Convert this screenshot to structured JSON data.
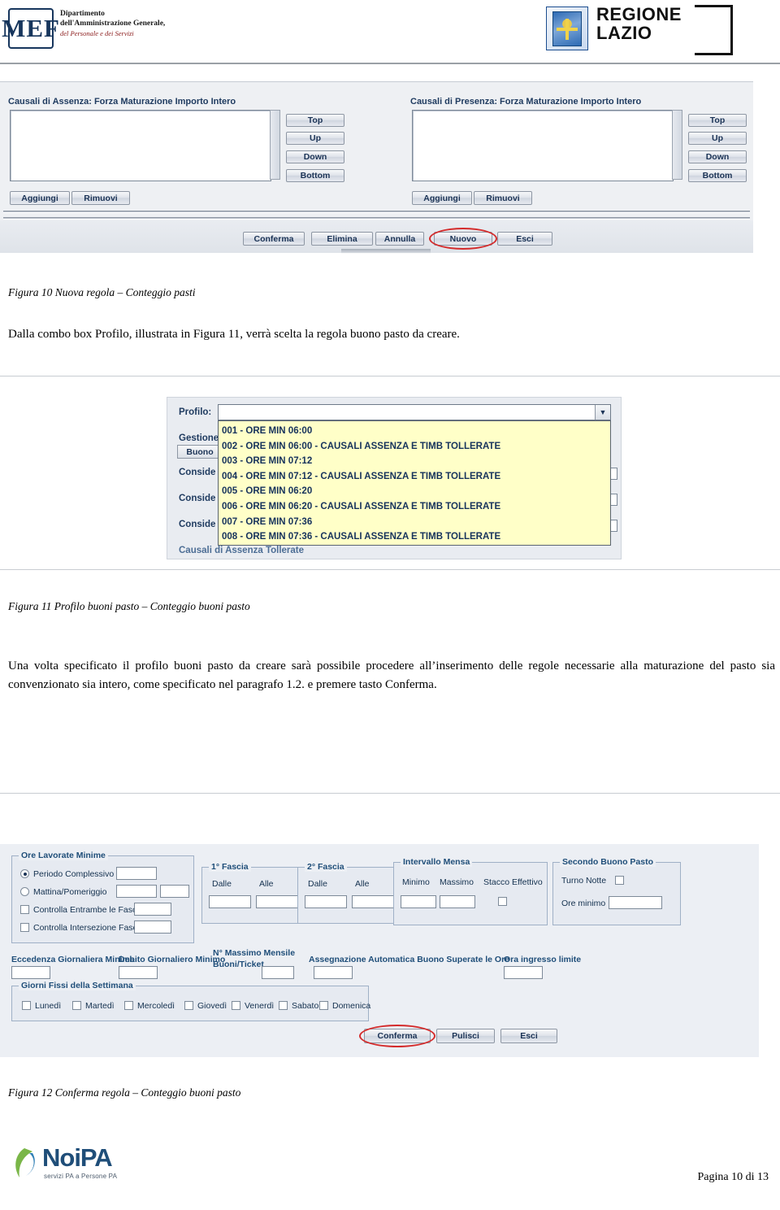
{
  "header": {
    "mef_logo_text": "MEF",
    "dept_line1": "Dipartimento",
    "dept_line2": "dell'Amministrazione Generale,",
    "dept_line3": "del Personale e dei Servizi",
    "regione_line1": "REGIONE",
    "regione_line2": "LAZIO"
  },
  "figure10": {
    "left_group_label": "Causali di Assenza: Forza Maturazione Importo Intero",
    "right_group_label": "Causali di Presenza: Forza Maturazione Importo Intero",
    "order_buttons": [
      "Top",
      "Up",
      "Down",
      "Bottom"
    ],
    "left_actions": [
      "Aggiungi",
      "Rimuovi"
    ],
    "right_actions": [
      "Aggiungi",
      "Rimuovi"
    ],
    "bottom_buttons": [
      "Conferma",
      "Elimina",
      "Annulla",
      "Nuovo",
      "Esci"
    ],
    "highlighted_button": "Nuovo"
  },
  "caption10": "Figura 10 Nuova regola – Conteggio pasti",
  "paragraph1": "Dalla combo box Profilo, illustrata in Figura 11, verrà scelta la regola buono pasto da creare.",
  "figure11": {
    "combo_label": "Profilo:",
    "combo_value": "",
    "dropdown_arrow": "▼",
    "background_labels": [
      "Gestione",
      "Buono",
      "Conside",
      "Conside",
      "Conside",
      "Causali di Assenza Tollerate"
    ],
    "options": [
      "001 - ORE MIN 06:00",
      "002 - ORE MIN 06:00 - CAUSALI ASSENZA E TIMB TOLLERATE",
      "003 - ORE MIN 07:12",
      "004 - ORE MIN 07:12 - CAUSALI ASSENZA E TIMB TOLLERATE",
      "005 - ORE MIN 06:20",
      "006 - ORE MIN 06:20 - CAUSALI ASSENZA E TIMB TOLLERATE",
      "007 - ORE MIN 07:36",
      "008 - ORE MIN 07:36 - CAUSALI ASSENZA E TIMB TOLLERATE"
    ]
  },
  "caption11": "Figura 11 Profilo buoni pasto – Conteggio buoni pasto",
  "paragraph2": "Una volta specificato il profilo buoni pasto da creare sarà possibile procedere all’inserimento delle regole necessarie alla maturazione del pasto sia convenzionato sia intero, come specificato nel paragrafo 1.2. e premere tasto Conferma.",
  "figure12": {
    "groups": {
      "ore_lavorate_minime": "Ore Lavorate Minime",
      "prima_fascia": "1° Fascia",
      "seconda_fascia": "2° Fascia",
      "intervallo_mensa": "Intervallo Mensa",
      "secondo_buono_pasto": "Secondo Buono Pasto",
      "giorni_fissi": "Giorni Fissi della Settimana"
    },
    "radio_periodo": "Periodo Complessivo",
    "radio_mattina": "Mattina/Pomeriggio",
    "chk_entrambe": "Controlla Entrambe le Fasce",
    "chk_intersezione": "Controlla Intersezione Fasce",
    "fascia1_dalle": "Dalle",
    "fascia1_alle": "Alle",
    "fascia2_dalle": "Dalle",
    "fascia2_alle": "Alle",
    "mensa_minimo": "Minimo",
    "mensa_massimo": "Massimo",
    "mensa_stacco": "Stacco Effettivo",
    "turno_notte": "Turno Notte",
    "ore_minimo": "Ore minimo",
    "eccedenza": "Eccedenza Giornaliera Minima",
    "debito": "Debito Giornaliero Minimo",
    "max_mensile_l1": "N° Massimo Mensile",
    "max_mensile_l2": "Buoni/Ticket",
    "assegnazione": "Assegnazione Automatica Buono Superate le Ore",
    "ora_ingresso": "Ora ingresso limite",
    "days": [
      "Lunedì",
      "Martedì",
      "Mercoledì",
      "Giovedì",
      "Venerdì",
      "Sabato",
      "Domenica"
    ],
    "buttons": [
      "Conferma",
      "Pulisci",
      "Esci"
    ],
    "highlighted_button": "Conferma"
  },
  "caption12": "Figura 12 Conferma regola – Conteggio buoni pasto",
  "footer": {
    "logo_word": "NoiPA",
    "logo_sub": "servizi PA a Persone PA",
    "page_number": "Pagina 10 di 13"
  }
}
